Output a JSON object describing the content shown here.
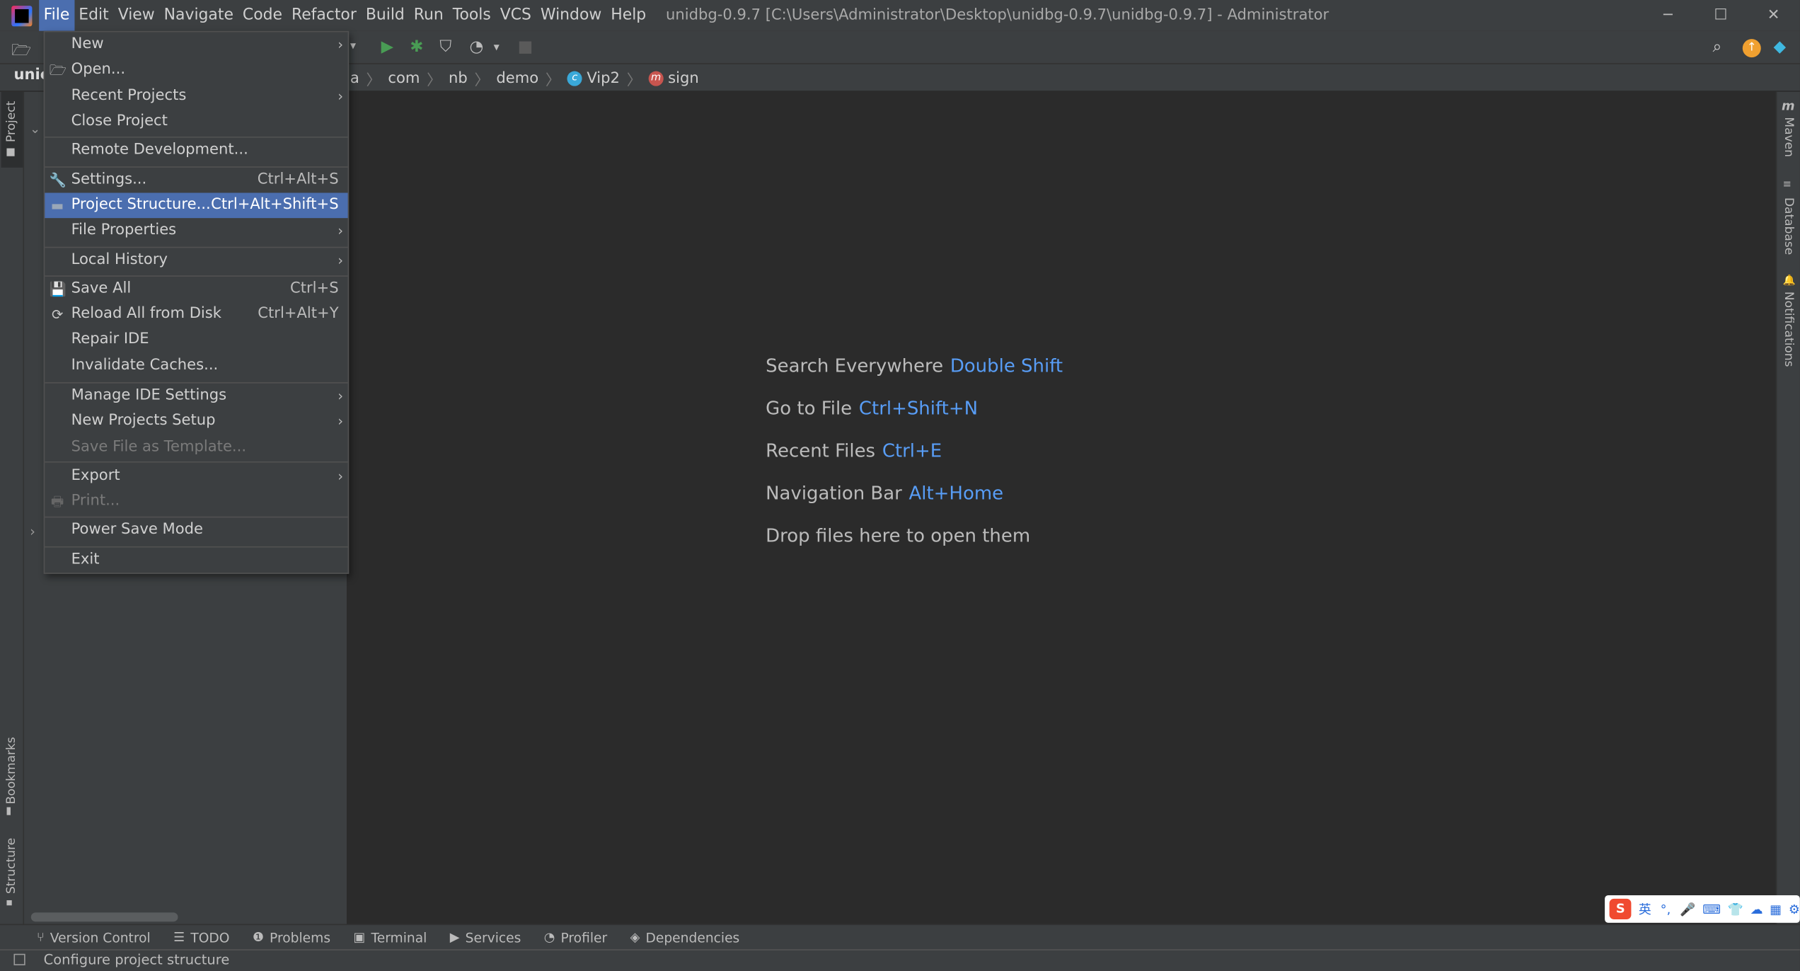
{
  "window": {
    "title": "unidbg-0.9.7 [C:\\Users\\Administrator\\Desktop\\unidbg-0.9.7\\unidbg-0.9.7] - Administrator",
    "minimize": "─",
    "maximize": "☐",
    "close": "✕"
  },
  "menubar": [
    "File",
    "Edit",
    "View",
    "Navigate",
    "Code",
    "Refactor",
    "Build",
    "Run",
    "Tools",
    "VCS",
    "Window",
    "Help"
  ],
  "project_label": "unic",
  "breadcrumbs": [
    {
      "text": "a",
      "icon": ""
    },
    {
      "text": "com",
      "icon": ""
    },
    {
      "text": "nb",
      "icon": ""
    },
    {
      "text": "demo",
      "icon": ""
    },
    {
      "text": "Vip2",
      "icon": "class-icon"
    },
    {
      "text": "sign",
      "icon": "method-icon"
    }
  ],
  "file_menu": [
    {
      "label": "New",
      "shortcut": "",
      "submenu": true,
      "icon": "",
      "disabled": false,
      "selected": false
    },
    {
      "label": "Open...",
      "shortcut": "",
      "submenu": false,
      "icon": "folder-open-icon",
      "disabled": false,
      "selected": false
    },
    {
      "label": "Recent Projects",
      "shortcut": "",
      "submenu": true,
      "icon": "",
      "disabled": false,
      "selected": false
    },
    {
      "label": "Close Project",
      "shortcut": "",
      "submenu": false,
      "icon": "",
      "disabled": false,
      "selected": false
    },
    {
      "label": "Remote Development...",
      "shortcut": "",
      "submenu": false,
      "icon": "",
      "disabled": false,
      "selected": false
    },
    {
      "label": "Settings...",
      "shortcut": "Ctrl+Alt+S",
      "submenu": false,
      "icon": "wrench-icon",
      "disabled": false,
      "selected": false
    },
    {
      "label": "Project Structure...",
      "shortcut": "Ctrl+Alt+Shift+S",
      "submenu": false,
      "icon": "project-structure-icon",
      "disabled": false,
      "selected": true
    },
    {
      "label": "File Properties",
      "shortcut": "",
      "submenu": true,
      "icon": "",
      "disabled": false,
      "selected": false
    },
    {
      "label": "Local History",
      "shortcut": "",
      "submenu": true,
      "icon": "",
      "disabled": false,
      "selected": false
    },
    {
      "label": "Save All",
      "shortcut": "Ctrl+S",
      "submenu": false,
      "icon": "save-icon",
      "disabled": false,
      "selected": false
    },
    {
      "label": "Reload All from Disk",
      "shortcut": "Ctrl+Alt+Y",
      "submenu": false,
      "icon": "reload-icon",
      "disabled": false,
      "selected": false
    },
    {
      "label": "Repair IDE",
      "shortcut": "",
      "submenu": false,
      "icon": "",
      "disabled": false,
      "selected": false
    },
    {
      "label": "Invalidate Caches...",
      "shortcut": "",
      "submenu": false,
      "icon": "",
      "disabled": false,
      "selected": false
    },
    {
      "label": "Manage IDE Settings",
      "shortcut": "",
      "submenu": true,
      "icon": "",
      "disabled": false,
      "selected": false
    },
    {
      "label": "New Projects Setup",
      "shortcut": "",
      "submenu": true,
      "icon": "",
      "disabled": false,
      "selected": false
    },
    {
      "label": "Save File as Template...",
      "shortcut": "",
      "submenu": false,
      "icon": "",
      "disabled": true,
      "selected": false
    },
    {
      "label": "Export",
      "shortcut": "",
      "submenu": true,
      "icon": "",
      "disabled": false,
      "selected": false
    },
    {
      "label": "Print...",
      "shortcut": "",
      "submenu": false,
      "icon": "print-icon",
      "disabled": true,
      "selected": false
    },
    {
      "label": "Power Save Mode",
      "shortcut": "",
      "submenu": false,
      "icon": "",
      "disabled": false,
      "selected": false
    },
    {
      "label": "Exit",
      "shortcut": "",
      "submenu": false,
      "icon": "",
      "disabled": false,
      "selected": false
    }
  ],
  "editor_hints": [
    {
      "label": "Search Everywhere",
      "key": "Double Shift"
    },
    {
      "label": "Go to File",
      "key": "Ctrl+Shift+N"
    },
    {
      "label": "Recent Files",
      "key": "Ctrl+E"
    },
    {
      "label": "Navigation Bar",
      "key": "Alt+Home"
    },
    {
      "label": "Drop files here to open them",
      "key": ""
    }
  ],
  "left_tabs": {
    "project": "Project",
    "bookmarks": "Bookmarks",
    "structure": "Structure"
  },
  "right_tabs": {
    "maven": "Maven",
    "database": "Database",
    "notifications": "Notifications"
  },
  "bottom_tabs": [
    {
      "label": "Version Control",
      "icon": "version-control-icon"
    },
    {
      "label": "TODO",
      "icon": "todo-icon"
    },
    {
      "label": "Problems",
      "icon": "problems-icon"
    },
    {
      "label": "Terminal",
      "icon": "terminal-icon"
    },
    {
      "label": "Services",
      "icon": "services-icon"
    },
    {
      "label": "Profiler",
      "icon": "profiler-icon"
    },
    {
      "label": "Dependencies",
      "icon": "dependencies-icon"
    }
  ],
  "status_text": "Configure project structure",
  "ime": {
    "lang": "英"
  },
  "colors": {
    "accent": "#4b6eaf",
    "link": "#589df6",
    "run": "#499c54"
  }
}
